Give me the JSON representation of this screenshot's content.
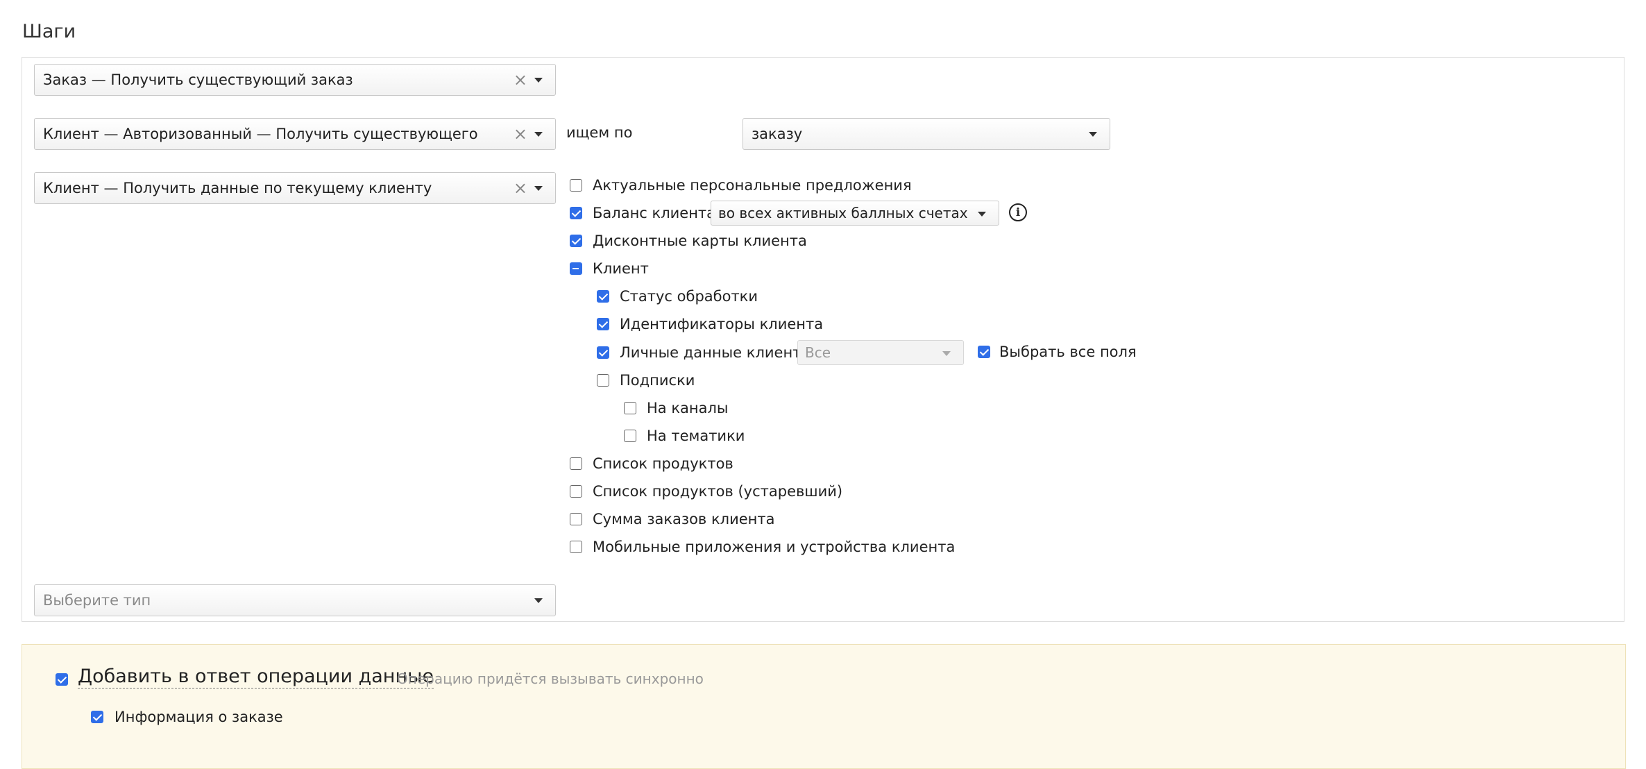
{
  "section_title": "Шаги",
  "steps": {
    "step1": {
      "value": "Заказ — Получить существующий заказ"
    },
    "step2": {
      "value": "Клиент — Авторизованный — Получить существующего",
      "search_label": "ищем по",
      "search_value": "заказу"
    },
    "step3": {
      "value": "Клиент — Получить данные по текущему клиенту"
    },
    "new_step_placeholder": "Выберите тип"
  },
  "options": {
    "personal_offers": {
      "label": "Актуальные персональные предложения",
      "checked": false
    },
    "balance": {
      "label": "Баланс клиента",
      "checked": true,
      "select_value": "во всех активных баллных счетах"
    },
    "discount_cards": {
      "label": "Дисконтные карты клиента",
      "checked": true
    },
    "client": {
      "label": "Клиент",
      "state": "mixed"
    },
    "processing_status": {
      "label": "Статус обработки",
      "checked": true
    },
    "client_ids": {
      "label": "Идентификаторы клиента",
      "checked": true
    },
    "personal_data": {
      "label": "Личные данные клиента",
      "checked": true,
      "select_value": "Все"
    },
    "select_all_fields": {
      "label": "Выбрать все поля",
      "checked": true
    },
    "subscriptions": {
      "label": "Подписки",
      "checked": false
    },
    "channels": {
      "label": "На каналы",
      "checked": false
    },
    "topics": {
      "label": "На тематики",
      "checked": false
    },
    "product_list": {
      "label": "Список продуктов",
      "checked": false
    },
    "product_list_old": {
      "label": "Список продуктов (устаревший)",
      "checked": false
    },
    "orders_sum": {
      "label": "Сумма заказов клиента",
      "checked": false
    },
    "mobile_apps": {
      "label": "Мобильные приложения и устройства клиента",
      "checked": false
    }
  },
  "response": {
    "add_data_label": "Добавить в ответ операции данные",
    "add_data_checked": true,
    "hint": "Операцию придётся вызывать синхронно",
    "order_info_label": "Информация о заказе",
    "order_info_checked": true
  },
  "icons": {
    "clear": "clear-icon",
    "dropdown": "chevron-down-icon",
    "info": "info-icon"
  },
  "colors": {
    "accent": "#2f6ee8",
    "notice_bg": "#fdf9ea"
  }
}
